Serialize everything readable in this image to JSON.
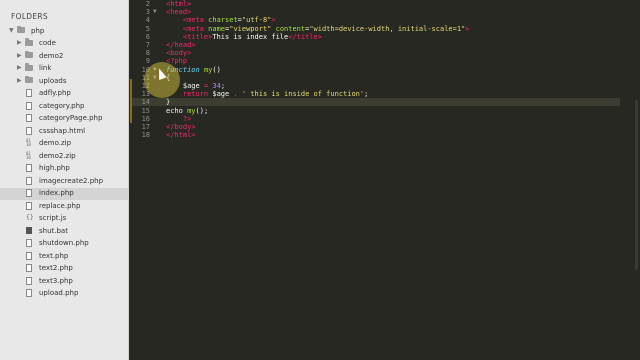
{
  "sidebar": {
    "title": "FOLDERS",
    "root": {
      "name": "php",
      "expanded": true
    },
    "items": [
      {
        "name": "code",
        "kind": "folder"
      },
      {
        "name": "demo2",
        "kind": "folder"
      },
      {
        "name": "link",
        "kind": "folder"
      },
      {
        "name": "uploads",
        "kind": "folder"
      },
      {
        "name": "adfly.php",
        "kind": "file"
      },
      {
        "name": "category.php",
        "kind": "file"
      },
      {
        "name": "categoryPage.php",
        "kind": "file"
      },
      {
        "name": "cssshap.html",
        "kind": "file"
      },
      {
        "name": "demo.zip",
        "kind": "zip"
      },
      {
        "name": "demo2.zip",
        "kind": "zip"
      },
      {
        "name": "high.php",
        "kind": "file"
      },
      {
        "name": "imagecreate2.php",
        "kind": "file"
      },
      {
        "name": "index.php",
        "kind": "file",
        "selected": true
      },
      {
        "name": "replace.php",
        "kind": "file"
      },
      {
        "name": "script.js",
        "kind": "js"
      },
      {
        "name": "shut.bat",
        "kind": "bat"
      },
      {
        "name": "shutdown.php",
        "kind": "file"
      },
      {
        "name": "text.php",
        "kind": "file"
      },
      {
        "name": "text2.php",
        "kind": "file"
      },
      {
        "name": "text3.php",
        "kind": "file"
      },
      {
        "name": "upload.php",
        "kind": "file"
      }
    ]
  },
  "editor": {
    "current_line": 14,
    "lines": [
      {
        "n": "2",
        "fold": "",
        "tokens": [
          [
            "tag",
            "<html>"
          ]
        ]
      },
      {
        "n": "3",
        "fold": "▼",
        "tokens": [
          [
            "tag",
            "<head>"
          ]
        ]
      },
      {
        "n": "4",
        "fold": "",
        "tokens": [
          [
            "plain",
            "    "
          ],
          [
            "tag",
            "<meta"
          ],
          [
            "plain",
            " "
          ],
          [
            "attr",
            "charset"
          ],
          [
            "plain",
            "="
          ],
          [
            "str",
            "\"utf-8\""
          ],
          [
            "tag",
            ">"
          ]
        ]
      },
      {
        "n": "5",
        "fold": "",
        "tokens": [
          [
            "plain",
            "    "
          ],
          [
            "tag",
            "<meta"
          ],
          [
            "plain",
            " "
          ],
          [
            "attr",
            "name"
          ],
          [
            "plain",
            "="
          ],
          [
            "str",
            "\"viewport\""
          ],
          [
            "plain",
            " "
          ],
          [
            "attr",
            "content"
          ],
          [
            "plain",
            "="
          ],
          [
            "str",
            "\"width=device-width, initial-scale=1\""
          ],
          [
            "tag",
            ">"
          ]
        ]
      },
      {
        "n": "6",
        "fold": "",
        "tokens": [
          [
            "plain",
            "    "
          ],
          [
            "tag",
            "<title>"
          ],
          [
            "plain",
            "This is index file"
          ],
          [
            "tag",
            "</title>"
          ]
        ]
      },
      {
        "n": "7",
        "fold": "",
        "tokens": [
          [
            "tag",
            "</head>"
          ]
        ]
      },
      {
        "n": "8",
        "fold": "",
        "tokens": [
          [
            "tag",
            "<body>"
          ]
        ]
      },
      {
        "n": "9",
        "fold": "",
        "tokens": [
          [
            "tag",
            "<?php"
          ]
        ]
      },
      {
        "n": "10",
        "fold": "▼",
        "tokens": [
          [
            "kw",
            "function"
          ],
          [
            "plain",
            " "
          ],
          [
            "fn",
            "my"
          ],
          [
            "plain",
            "()"
          ]
        ]
      },
      {
        "n": "11",
        "fold": "▼",
        "tokens": [
          [
            "plain",
            "{"
          ]
        ]
      },
      {
        "n": "12",
        "fold": "",
        "tokens": [
          [
            "plain",
            "    $age "
          ],
          [
            "op",
            "="
          ],
          [
            "plain",
            " "
          ],
          [
            "num",
            "34"
          ],
          [
            "plain",
            ";"
          ]
        ]
      },
      {
        "n": "13",
        "fold": "",
        "tokens": [
          [
            "plain",
            "    "
          ],
          [
            "op",
            "return"
          ],
          [
            "plain",
            " $age "
          ],
          [
            "op",
            "."
          ],
          [
            "plain",
            " "
          ],
          [
            "str",
            "' this is inside of function'"
          ],
          [
            "plain",
            ";"
          ]
        ]
      },
      {
        "n": "14",
        "fold": "",
        "tokens": [
          [
            "plain",
            "}"
          ]
        ]
      },
      {
        "n": "15",
        "fold": "",
        "tokens": [
          [
            "plain",
            "echo "
          ],
          [
            "fn",
            "my"
          ],
          [
            "plain",
            "();"
          ]
        ]
      },
      {
        "n": "16",
        "fold": "",
        "tokens": [
          [
            "plain",
            "    "
          ],
          [
            "tag",
            "?>"
          ]
        ]
      },
      {
        "n": "17",
        "fold": "",
        "tokens": [
          [
            "tag",
            "</body>"
          ]
        ]
      },
      {
        "n": "18",
        "fold": "",
        "tokens": [
          [
            "tag",
            "</html>"
          ]
        ]
      }
    ]
  },
  "colors": {
    "editor_bg": "#272822",
    "sidebar_bg": "#e8e8e8",
    "tag": "#f92672",
    "attr": "#a6e22e",
    "string": "#e6db74",
    "keyword": "#66d9ef",
    "number": "#ae81ff",
    "cursor_highlight": "#e6d23c"
  }
}
